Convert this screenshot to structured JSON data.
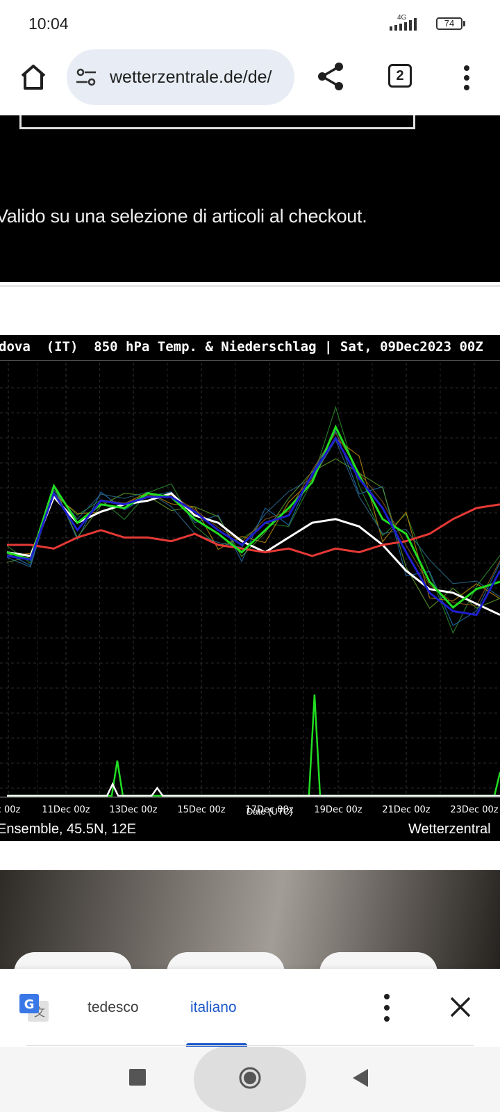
{
  "status_bar": {
    "time": "10:04",
    "network": "4G",
    "battery": "74"
  },
  "browser": {
    "url": "wetterzentrale.de/de/",
    "tab_count": "2",
    "icons": [
      "home-icon",
      "site-settings-icon",
      "share-icon",
      "tab-switcher-icon",
      "more-vert-icon"
    ]
  },
  "ad": {
    "text": "Valido su una selezione di articoli al checkout."
  },
  "chart_data": {
    "type": "line",
    "title": "dova  (IT)  850 hPa Temp. & Niederschlag | Sat, 09Dec2023 00Z",
    "xlabel": "Date (UTC)",
    "ylabel": "",
    "x_ticks": [
      "c 00z",
      "11Dec 00z",
      "13Dec 00z",
      "15Dec 00z",
      "17Dec 00z",
      "19Dec 00z",
      "21Dec 00z",
      "23Dec 00z"
    ],
    "footer_left": "Ensemble, 45.5N, 12E",
    "footer_right": "Wetterzentral",
    "grid": true,
    "background": "#000000",
    "series": [
      {
        "color": "#ffffff",
        "role": "mean",
        "values": [
          0.58,
          0.57,
          0.73,
          0.66,
          0.69,
          0.71,
          0.72,
          0.74,
          0.68,
          0.66,
          0.61,
          0.58,
          0.62,
          0.66,
          0.67,
          0.65,
          0.6,
          0.53,
          0.48,
          0.47,
          0.44,
          0.41
        ]
      },
      {
        "color": "#e53935",
        "role": "control",
        "values": [
          0.6,
          0.6,
          0.59,
          0.62,
          0.64,
          0.62,
          0.62,
          0.61,
          0.63,
          0.6,
          0.59,
          0.58,
          0.59,
          0.57,
          0.59,
          0.58,
          0.6,
          0.61,
          0.63,
          0.67,
          0.7,
          0.71
        ]
      },
      {
        "color": "#22dd22",
        "role": "member",
        "values": [
          0.58,
          0.56,
          0.76,
          0.66,
          0.71,
          0.7,
          0.74,
          0.73,
          0.67,
          0.63,
          0.58,
          0.64,
          0.7,
          0.77,
          0.92,
          0.79,
          0.67,
          0.63,
          0.5,
          0.43,
          0.48,
          0.5
        ]
      },
      {
        "color": "#1e1ecc",
        "role": "member",
        "values": [
          0.57,
          0.56,
          0.74,
          0.64,
          0.72,
          0.71,
          0.73,
          0.73,
          0.69,
          0.64,
          0.6,
          0.66,
          0.68,
          0.79,
          0.89,
          0.78,
          0.7,
          0.58,
          0.47,
          0.42,
          0.41,
          0.53
        ]
      }
    ],
    "precip_series": [
      {
        "color": "#22dd22",
        "peaks": [
          {
            "x_index": 4.7,
            "value": 0.09
          },
          {
            "x_index": 13.1,
            "value": 0.26
          },
          {
            "x_index": 21.0,
            "value": 0.06
          }
        ]
      },
      {
        "color": "#ffffff",
        "peaks": [
          {
            "x_index": 4.5,
            "value": 0.03
          },
          {
            "x_index": 6.4,
            "value": 0.02
          }
        ]
      }
    ]
  },
  "translate_bar": {
    "source_lang": "tedesco",
    "target_lang": "italiano"
  }
}
